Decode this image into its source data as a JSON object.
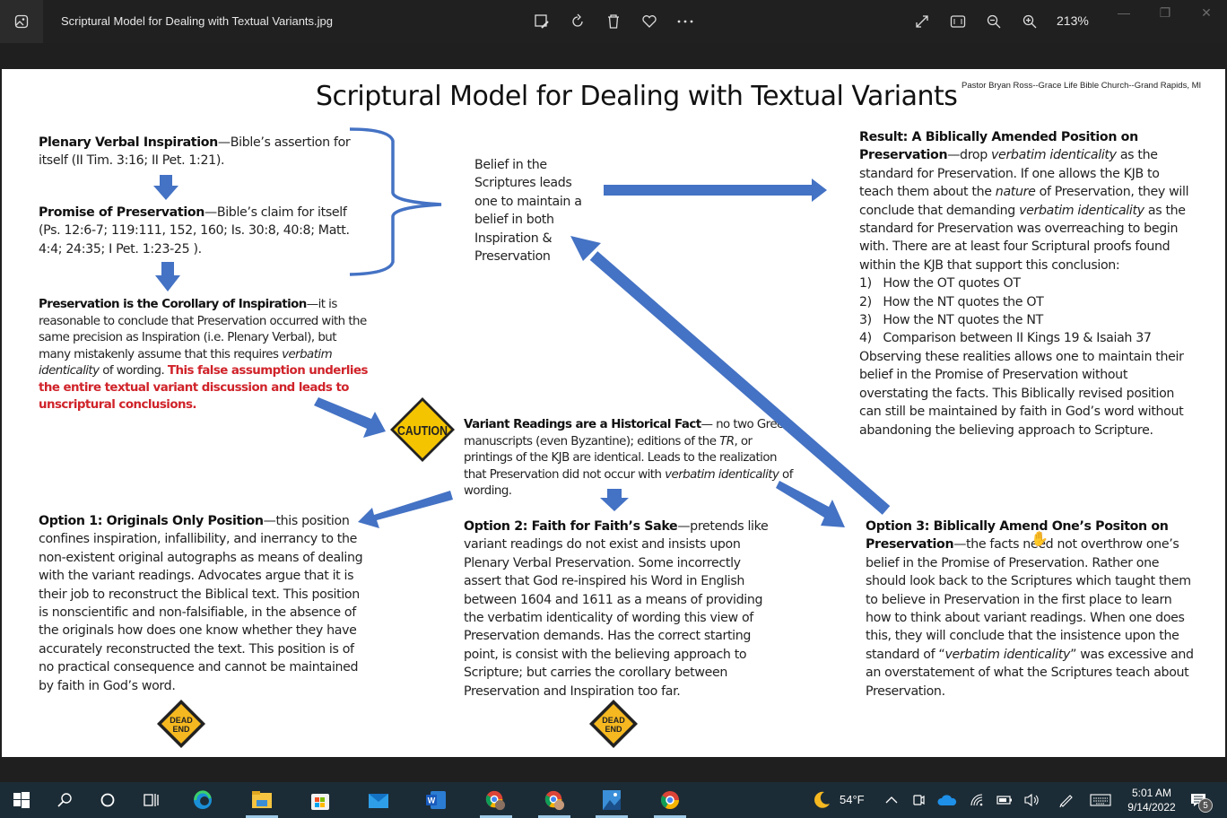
{
  "window": {
    "file_name": "Scriptural Model for Dealing with Textual Variants.jpg",
    "zoom_level": "213%",
    "toolbar_icons": [
      "edit-image-icon",
      "rotate-icon",
      "delete-icon",
      "favorite-icon",
      "more-icon"
    ],
    "view_icons": [
      "fullscreen-icon",
      "fit-to-window-icon",
      "zoom-out-icon",
      "zoom-in-icon"
    ],
    "window_controls": [
      "minimize",
      "restore",
      "close"
    ]
  },
  "slide": {
    "title": "Scriptural Model for Dealing with Textual Variants",
    "author": "Pastor Bryan Ross--Grace Life Bible Church--Grand Rapids, MI",
    "inspiration": {
      "heading": "Plenary Verbal Inspiration",
      "body": "—Bible’s assertion for itself (II Tim. 3:16; II Pet. 1:21)."
    },
    "preservation_promise": {
      "heading": "Promise of Preservation",
      "body": "—Bible’s claim for itself (Ps. 12:6-7; 119:111, 152, 160; Is. 30:8, 40:8; Matt. 4:4; 24:35; I Pet. 1:23-25 )."
    },
    "corollary": {
      "heading": "Preservation is the Corollary of Inspiration",
      "body1": "—it is reasonable to conclude that Preservation occurred with the same precision as Inspiration (i.e. Plenary Verbal), but many mistakenly assume that this requires ",
      "italic": "verbatim identicality",
      "body2": " of wording. ",
      "warning": "This false assumption underlies the entire textual variant discussion and leads to unscriptural conclusions."
    },
    "belief": "Belief in the Scriptures leads one to maintain a belief in both Inspiration & Preservation",
    "variant_fact": {
      "heading": "Variant Readings are a Historical Fact",
      "body1": "— no two Greek manuscripts (even Byzantine); editions of the ",
      "tr": "TR",
      "body2": ", or printings of the KJB are identical.  Leads to the realization that Preservation did not occur with ",
      "italic": "verbatim identicality",
      "body3": " of wording."
    },
    "caution_sign": "CAUTION",
    "dead_end_sign": "DEAD END",
    "result": {
      "heading": "Result: A Biblically Amended Position on Preservation",
      "p1": "—drop ",
      "i1": "verbatim identicality",
      "p2": " as the standard for Preservation.  If one allows the KJB to teach them about the ",
      "i2": "nature",
      "p3": " of Preservation, they will conclude that demanding ",
      "i3": "verbatim identicality",
      "p4": " as the standard for Preservation was overreaching to begin with.  There are at least four Scriptural proofs  found within the KJB that support this conclusion:",
      "list": [
        "1)   How the OT quotes OT",
        "2)   How the NT quotes the OT",
        "3)   How the NT quotes the NT",
        "4)   Comparison between II Kings 19 & Isaiah 37"
      ],
      "closing": "Observing these realities allows one to maintain their belief in the Promise of Preservation without overstating the facts.  This  Biblically revised position can still be maintained by faith in God’s word without  abandoning the believing approach to Scripture."
    },
    "option1": {
      "heading": "Option 1: Originals Only Position",
      "body": "—this position confines inspiration, infallibility, and inerrancy to the non-existent original autographs as means of dealing with the variant readings.  Advocates argue that it is their job to reconstruct the Biblical text.  This position is nonscientific and non-falsifiable, in the absence of the originals how does one know whether they have accurately reconstructed the text.  This position is of no practical consequence and cannot be maintained by faith in God’s word."
    },
    "option2": {
      "heading": "Option 2: Faith for Faith’s Sake",
      "body": "—pretends like variant readings do not exist and insists upon Plenary Verbal Preservation.  Some incorrectly assert that God re-inspired his Word  in English between 1604 and 1611 as a means of providing the verbatim identicality of wording this view of Preservation demands.  Has the correct starting point, is consist with the believing approach to Scripture; but carries the corollary between Preservation and Inspiration too far."
    },
    "option3": {
      "heading": "Option 3: Biblically Amend One’s Positon on Preservation",
      "p1": "—the facts need not overthrow  one’s belief in the Promise of Preservation.  Rather one should look back to the Scriptures which taught them to believe in Preservation in the first place to learn how to think about variant readings.  When one does this, they will conclude that the insistence upon the standard of “",
      "italic": "verbatim identicality",
      "p2": "” was excessive and an overstatement of what the Scriptures teach about Preservation."
    },
    "colors": {
      "arrow": "#4472c4",
      "warning_text": "#d0232a",
      "sign_yellow": "#f5c400"
    }
  },
  "taskbar": {
    "apps": [
      "start",
      "search",
      "cortana",
      "task-view",
      "edge",
      "file-explorer",
      "store",
      "mail",
      "word",
      "chrome-profile-1",
      "chrome-profile-2",
      "photos",
      "chrome"
    ],
    "weather_temp": "54°F",
    "time": "5:01 AM",
    "date": "9/14/2022",
    "notification_count": "5"
  }
}
